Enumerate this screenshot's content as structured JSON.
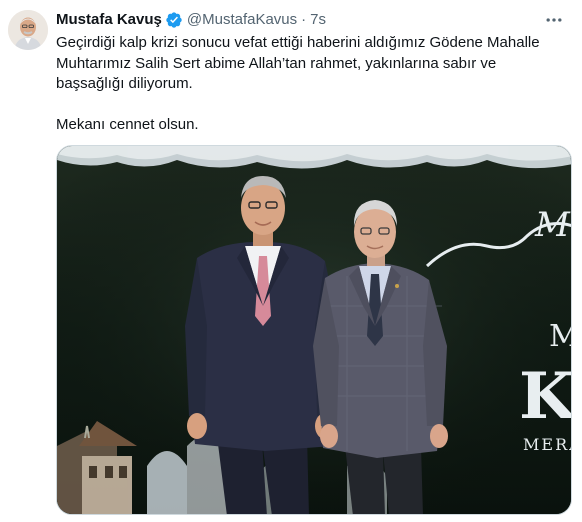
{
  "author": {
    "display_name": "Mustafa Kavuş",
    "handle": "@MustafaKavus",
    "separator": "·",
    "time": "7s",
    "verified_icon": "verified-badge-icon",
    "verified_color": "#1d9bf0"
  },
  "tweet": {
    "lines": [
      "Geçirdiği kalp krizi sonucu vefat ettiği haberini aldığımız Gödene Mahalle",
      "Muhtarımız Salih Sert abime Allah’tan rahmet, yakınlarına sabır ve",
      "başsağlığı diliyorum.",
      "Mekanı cennet olsun."
    ]
  },
  "media": {
    "backdrop_letters_right_1": "M",
    "backdrop_letters_right_2": "Ka",
    "backdrop_letters_right_3": "MERAI",
    "backdrop_script": "M."
  },
  "icons": {
    "more": "more-options-icon"
  }
}
